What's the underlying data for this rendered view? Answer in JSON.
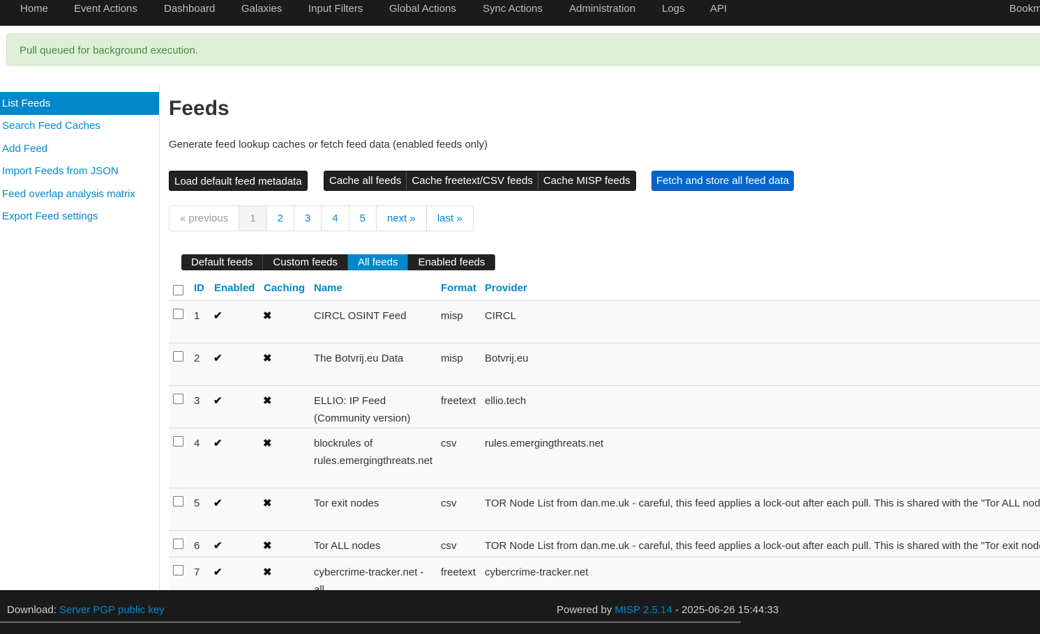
{
  "nav": {
    "items": [
      "Home",
      "Event Actions",
      "Dashboard",
      "Galaxies",
      "Input Filters",
      "Global Actions",
      "Sync Actions",
      "Administration",
      "Logs",
      "API"
    ],
    "right": "Bookm"
  },
  "flash": "Pull queued for background execution.",
  "sidebar": {
    "items": [
      "List Feeds",
      "Search Feed Caches",
      "Add Feed",
      "Import Feeds from JSON",
      "Feed overlap analysis matrix",
      "Export Feed settings"
    ]
  },
  "page": {
    "title": "Feeds",
    "description": "Generate feed lookup caches or fetch feed data (enabled feeds only)"
  },
  "actions": {
    "load_default": "Load default feed metadata",
    "cache_all": "Cache all feeds",
    "cache_freetext": "Cache freetext/CSV feeds",
    "cache_misp": "Cache MISP feeds",
    "fetch_all": "Fetch and store all feed data"
  },
  "pagination": {
    "previous": "« previous",
    "pages": [
      "1",
      "2",
      "3",
      "4",
      "5"
    ],
    "next": "next »",
    "last": "last »"
  },
  "filters": [
    "Default feeds",
    "Custom feeds",
    "All feeds",
    "Enabled feeds"
  ],
  "table": {
    "headers": {
      "id": "ID",
      "enabled": "Enabled",
      "caching": "Caching",
      "name": "Name",
      "format": "Format",
      "provider": "Provider"
    },
    "check_mark": "✔",
    "cross_mark": "✖",
    "rows": [
      {
        "id": "1",
        "name": "CIRCL OSINT Feed",
        "format": "misp",
        "provider": "CIRCL"
      },
      {
        "id": "2",
        "name": "The Botvrij.eu Data",
        "format": "misp",
        "provider": "Botvrij.eu"
      },
      {
        "id": "3",
        "name": "ELLIO: IP Feed (Community version)",
        "format": "freetext",
        "provider": "ellio.tech"
      },
      {
        "id": "4",
        "name": "blockrules of rules.emergingthreats.net",
        "format": "csv",
        "provider": "rules.emergingthreats.net"
      },
      {
        "id": "5",
        "name": "Tor exit nodes",
        "format": "csv",
        "provider": "TOR Node List from dan.me.uk - careful, this feed applies a lock-out after each pull. This is shared with the \"Tor ALL nodes\" feed."
      },
      {
        "id": "6",
        "name": "Tor ALL nodes",
        "format": "csv",
        "provider": "TOR Node List from dan.me.uk - careful, this feed applies a lock-out after each pull. This is shared with the \"Tor exit nodes\" feed."
      },
      {
        "id": "7",
        "name": "cybercrime-tracker.net - all",
        "format": "freetext",
        "provider": "cybercrime-tracker.net"
      }
    ]
  },
  "footer": {
    "download_label": "Download:",
    "download_link": "Server PGP public key",
    "powered_label": "Powered by",
    "misp_link": "MISP 2.5.14",
    "timestamp": "- 2025-06-26 15:44:33"
  }
}
